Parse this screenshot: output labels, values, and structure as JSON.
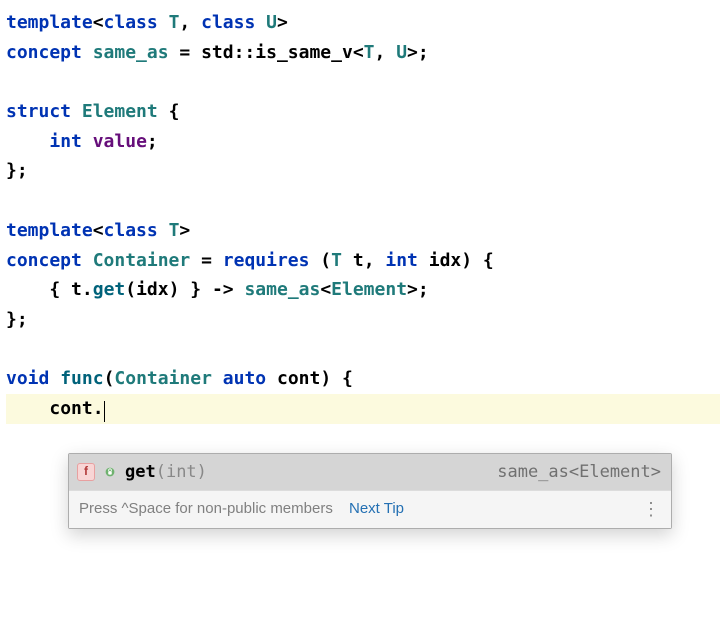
{
  "code": {
    "line1": {
      "kw_tpl": "template",
      "open": "<",
      "kw_cls1": "class",
      "sp1": " ",
      "T": "T",
      "comma": ", ",
      "kw_cls2": "class",
      "sp2": " ",
      "U": "U",
      "close": ">"
    },
    "line2": {
      "kw_concept": "concept",
      "sp1": " ",
      "same_as": "same_as",
      "eq": " = ",
      "std": "std",
      "dcolon": "::",
      "is_same_v": "is_same_v",
      "open": "<",
      "T": "T",
      "comma": ", ",
      "U": "U",
      "close": ">;"
    },
    "line4": {
      "kw_struct": "struct",
      "sp": " ",
      "Element": "Element",
      "brace": " {"
    },
    "line5": {
      "indent": "    ",
      "kw_int": "int",
      "sp": " ",
      "value": "value",
      "semi": ";"
    },
    "line6": {
      "close": "};"
    },
    "line8": {
      "kw_tpl": "template",
      "open": "<",
      "kw_cls": "class",
      "sp": " ",
      "T": "T",
      "close": ">"
    },
    "line9": {
      "kw_concept": "concept",
      "sp1": " ",
      "Container": "Container",
      "eq": " = ",
      "kw_requires": "requires",
      "paren": " (",
      "T": "T",
      "sp2": " ",
      "t": "t",
      "comma": ", ",
      "kw_int": "int",
      "sp3": " ",
      "idx": "idx",
      "pclose": ") {"
    },
    "line10": {
      "indent": "    ",
      "open": "{ ",
      "t": "t",
      "dot": ".",
      "get": "get",
      "popen": "(",
      "idx": "idx",
      "pclose": ") } -> ",
      "same_as": "same_as",
      "aopen": "<",
      "Element": "Element",
      "aclose": ">;"
    },
    "line11": {
      "close": "};"
    },
    "line13": {
      "kw_void": "void",
      "sp1": " ",
      "func": "func",
      "popen": "(",
      "Container": "Container",
      "sp2": " ",
      "kw_auto": "auto",
      "sp3": " ",
      "cont": "cont",
      "pclose": ") {"
    },
    "line14": {
      "indent": "    ",
      "cont": "cont",
      "dot": "."
    }
  },
  "popup": {
    "badge_f": "f",
    "suggestion_name": "get",
    "suggestion_params": "(int)",
    "return_type": "same_as<Element>",
    "hint_prefix": "Press ",
    "hint_key": "^Space",
    "hint_suffix": " for non-public members",
    "next_tip": "Next Tip"
  }
}
